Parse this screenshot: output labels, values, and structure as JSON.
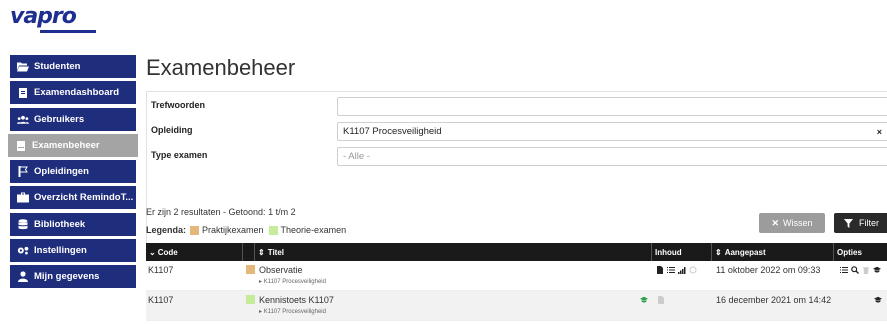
{
  "logo": {
    "text": "vapro"
  },
  "sidebar": {
    "items": [
      {
        "label": "Studenten",
        "icon": "folder-open-icon",
        "active": false
      },
      {
        "label": "Examendashboard",
        "icon": "clipboard-icon",
        "active": false
      },
      {
        "label": "Gebruikers",
        "icon": "users-icon",
        "active": false
      },
      {
        "label": "Examenbeheer",
        "icon": "clipboard-list-icon",
        "active": true
      },
      {
        "label": "Opleidingen",
        "icon": "flag-icon",
        "active": false
      },
      {
        "label": "Overzicht RemindoT...",
        "icon": "briefcase-icon",
        "active": false
      },
      {
        "label": "Bibliotheek",
        "icon": "database-icon",
        "active": false
      },
      {
        "label": "Instellingen",
        "icon": "cogs-icon",
        "active": false
      },
      {
        "label": "Mijn gegevens",
        "icon": "user-icon",
        "active": false
      }
    ]
  },
  "page": {
    "title": "Examenbeheer"
  },
  "filters": {
    "trefwoorden_label": "Trefwoorden",
    "trefwoorden_value": "",
    "opleiding_label": "Opleiding",
    "opleiding_value": "K1107 Procesveiligheid",
    "opleiding_clear": "×",
    "type_label": "Type examen",
    "type_placeholder": "- Alle -",
    "wissen_label": "Wissen",
    "filter_label": "Filter"
  },
  "results": {
    "summary": "Er zijn 2 resultaten - Getoond: 1 t/m 2",
    "legend_label": "Legenda:",
    "legend": [
      {
        "label": "Praktijkexamen",
        "color": "#e5b77a"
      },
      {
        "label": "Theorie-examen",
        "color": "#c6ec9b"
      }
    ]
  },
  "table": {
    "columns": [
      "Code",
      "",
      "Titel",
      "Inhoud",
      "Aangepast",
      "Opties"
    ],
    "rows": [
      {
        "code": "K1107",
        "type": "Praktijkexamen",
        "title": "Observatie",
        "subtitle": "K1107 Procesveiligheid",
        "date": "11 oktober 2022 om 09:33"
      },
      {
        "code": "K1107",
        "type": "Theorie-examen",
        "title": "Kennistoets K1107",
        "subtitle": "K1107 Procesveiligheid",
        "date": "16 december 2021 om 14:42"
      }
    ]
  },
  "colors": {
    "sidebar_bg": "#1f2d7d",
    "sidebar_active": "#a4a4a4",
    "header_bg": "#1a1a1a",
    "praktijk": "#e5b77a",
    "theorie": "#c6ec9b",
    "graduation_green": "#2e9c4a"
  }
}
